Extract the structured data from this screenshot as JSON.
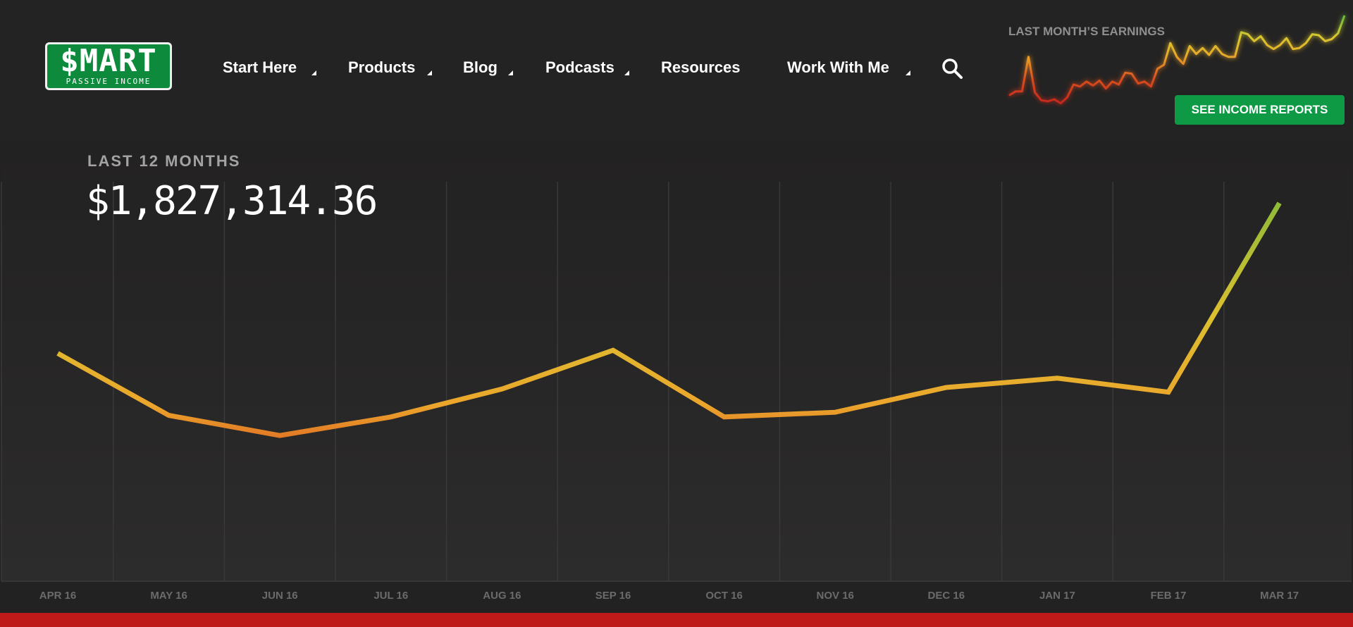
{
  "header": {
    "logo": {
      "main": "$MART",
      "sub": "PASSIVE INCOME"
    },
    "nav": [
      {
        "label": "Start Here",
        "has_caret": true
      },
      {
        "label": "Products",
        "has_caret": true
      },
      {
        "label": "Blog",
        "has_caret": true
      },
      {
        "label": "Podcasts",
        "has_caret": true
      },
      {
        "label": "Resources",
        "has_caret": false
      },
      {
        "label": "Work With Me",
        "has_caret": true
      }
    ],
    "search_icon": "search-icon"
  },
  "earnings_widget": {
    "title": "LAST MONTH’S EARNINGS",
    "button_label": "SEE INCOME REPORTS",
    "sparkline_values": [
      19,
      23,
      23,
      58,
      22,
      14,
      13,
      15,
      11,
      17,
      30,
      28,
      33,
      29,
      34,
      26,
      33,
      30,
      42,
      41,
      31,
      33,
      28,
      46,
      50,
      72,
      58,
      51,
      69,
      61,
      67,
      60,
      69,
      61,
      58,
      58,
      83,
      81,
      74,
      79,
      70,
      66,
      70,
      77,
      66,
      67,
      72,
      81,
      80,
      74,
      76,
      82,
      100
    ]
  },
  "chart_data": {
    "type": "line",
    "title": "LAST 12 MONTHS",
    "total_label": "$1,827,314.36",
    "categories": [
      "APR 16",
      "MAY 16",
      "JUN 16",
      "JUL 16",
      "AUG 16",
      "SEP 16",
      "OCT 16",
      "NOV 16",
      "DEC 16",
      "JAN 17",
      "FEB 17",
      "MAR 17"
    ],
    "values": [
      147000,
      107000,
      94000,
      106000,
      124000,
      149000,
      106000,
      109000,
      125000,
      131000,
      122000,
      244000
    ],
    "ylim": [
      0,
      285000
    ],
    "grid": true,
    "colors": {
      "low": "#c0161b",
      "mid": "#e8902a",
      "high": "#7cba3a"
    }
  },
  "colors": {
    "background": "#232222",
    "accent_green": "#0e9a45",
    "bottom_bar": "#bd1a19"
  }
}
